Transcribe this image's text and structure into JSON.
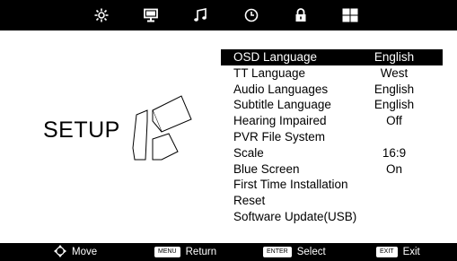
{
  "top_tabs": [
    {
      "name": "picture-icon"
    },
    {
      "name": "channel-icon"
    },
    {
      "name": "sound-icon"
    },
    {
      "name": "time-icon"
    },
    {
      "name": "lock-icon"
    },
    {
      "name": "setup-icon"
    }
  ],
  "title": "SETUP",
  "menu": {
    "items": [
      {
        "label": "OSD Language",
        "value": "English"
      },
      {
        "label": "TT Language",
        "value": "West"
      },
      {
        "label": "Audio Languages",
        "value": "English"
      },
      {
        "label": "Subtitle Language",
        "value": "English"
      },
      {
        "label": "Hearing Impaired",
        "value": "Off"
      },
      {
        "label": "PVR File System",
        "value": ""
      },
      {
        "label": "Scale",
        "value": "16:9"
      },
      {
        "label": "Blue Screen",
        "value": "On"
      },
      {
        "label": "First Time Installation",
        "value": ""
      },
      {
        "label": "Reset",
        "value": ""
      },
      {
        "label": "Software Update(USB)",
        "value": ""
      }
    ],
    "selected_index": 0
  },
  "bottom": {
    "move": "Move",
    "return_key": "MENU",
    "return_label": "Return",
    "select_key": "ENTER",
    "select_label": "Select",
    "exit_key": "EXIT",
    "exit_label": "Exit"
  },
  "colors": {
    "bar": "#000000",
    "background": "#ffffff",
    "highlight": "#000000"
  }
}
